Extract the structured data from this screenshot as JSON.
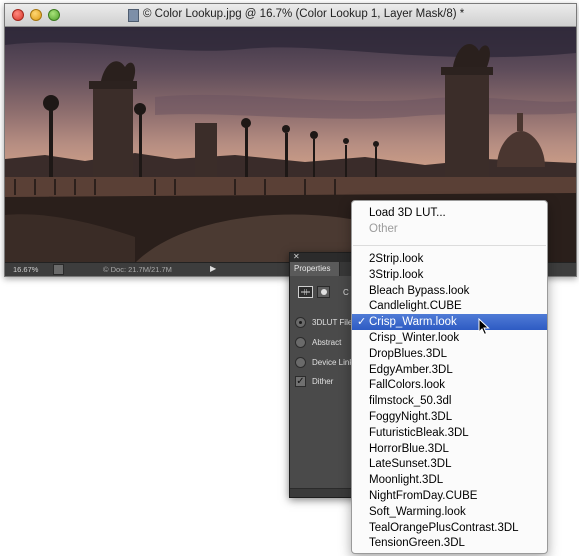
{
  "document": {
    "title": "© Color Lookup.jpg @ 16.7% (Color Lookup 1, Layer Mask/8) *",
    "zoom": "16.67%",
    "doc_size": "© Doc: 21.7M/21.7M"
  },
  "properties_panel": {
    "tab_label": "Properties",
    "heading_partial": "C",
    "options": [
      {
        "label": "3DLUT File",
        "selected": true
      },
      {
        "label": "Abstract",
        "selected": false
      },
      {
        "label": "Device Link",
        "selected": false
      }
    ],
    "dither": {
      "label": "Dither",
      "checked": true
    }
  },
  "lut_menu": {
    "load_label": "Load 3D LUT...",
    "other_label": "Other",
    "items": [
      {
        "label": "2Strip.look"
      },
      {
        "label": "3Strip.look"
      },
      {
        "label": "Bleach Bypass.look"
      },
      {
        "label": "Candlelight.CUBE"
      },
      {
        "label": "Crisp_Warm.look",
        "checked": true
      },
      {
        "label": "Crisp_Winter.look"
      },
      {
        "label": "DropBlues.3DL"
      },
      {
        "label": "EdgyAmber.3DL"
      },
      {
        "label": "FallColors.look"
      },
      {
        "label": "filmstock_50.3dl"
      },
      {
        "label": "FoggyNight.3DL"
      },
      {
        "label": "FuturisticBleak.3DL"
      },
      {
        "label": "HorrorBlue.3DL"
      },
      {
        "label": "LateSunset.3DL"
      },
      {
        "label": "Moonlight.3DL"
      },
      {
        "label": "NightFromDay.CUBE"
      },
      {
        "label": "Soft_Warming.look"
      },
      {
        "label": "TealOrangePlusContrast.3DL"
      },
      {
        "label": "TensionGreen.3DL"
      }
    ],
    "check_glyph": "✓"
  },
  "colors": {
    "menu_highlight": "#3565c8",
    "panel_bg": "#4a4a4a"
  }
}
